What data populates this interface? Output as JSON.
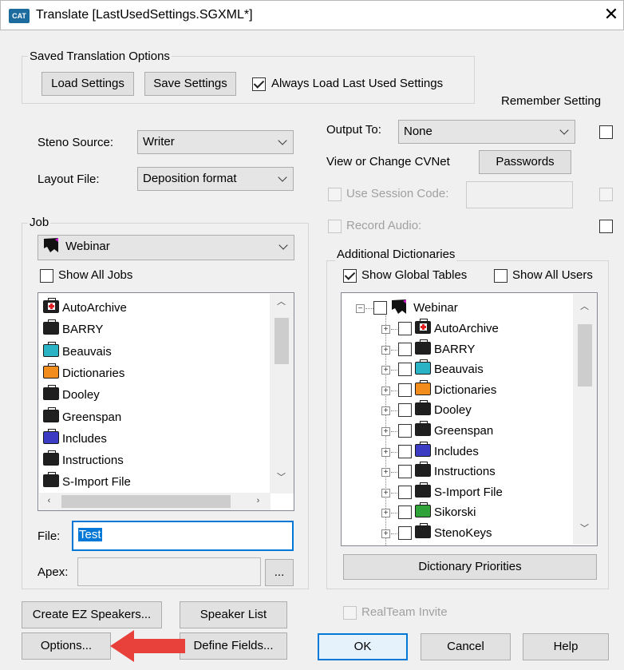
{
  "window": {
    "app_icon_text": "CAT",
    "title": "Translate [LastUsedSettings.SGXML*]",
    "close_glyph": "✕"
  },
  "saved_options": {
    "group_title": "Saved Translation Options",
    "load_label": "Load Settings",
    "save_label": "Save Settings",
    "always_load_label": "Always Load Last Used Settings",
    "always_load_checked": true
  },
  "remember_setting_label": "Remember Setting",
  "steno_source": {
    "label": "Steno Source:",
    "value": "Writer"
  },
  "layout_file": {
    "label": "Layout File:",
    "value": "Deposition format"
  },
  "output": {
    "label": "Output To:",
    "value": "None",
    "remember_checked": false
  },
  "cvnet": {
    "label": "View or Change CVNet",
    "button": "Passwords"
  },
  "session_code": {
    "label": "Use Session Code:",
    "value": ""
  },
  "record_audio": {
    "label": "Record Audio:"
  },
  "job": {
    "group_title": "Job",
    "selected": "Webinar",
    "show_all_label": "Show All Jobs",
    "items": [
      {
        "label": "AutoArchive",
        "color": "#1f1f1f",
        "cross": true
      },
      {
        "label": "BARRY",
        "color": "#1f1f1f",
        "cross": false
      },
      {
        "label": "Beauvais",
        "color": "#2ab3c4",
        "cross": false
      },
      {
        "label": "Dictionaries",
        "color": "#f28c1d",
        "cross": false
      },
      {
        "label": "Dooley",
        "color": "#1f1f1f",
        "cross": false
      },
      {
        "label": "Greenspan",
        "color": "#1f1f1f",
        "cross": false
      },
      {
        "label": "Includes",
        "color": "#3b3bc4",
        "cross": false
      },
      {
        "label": "Instructions",
        "color": "#1f1f1f",
        "cross": false
      },
      {
        "label": "S-Import File",
        "color": "#1f1f1f",
        "cross": false
      }
    ]
  },
  "file": {
    "label": "File:",
    "value": "Test"
  },
  "apex": {
    "label": "Apex:",
    "value": "",
    "browse": "..."
  },
  "dictionaries": {
    "group_title": "Additional Dictionaries",
    "show_global_label": "Show Global Tables",
    "show_global_checked": true,
    "show_all_users_label": "Show All Users",
    "root": "Webinar",
    "items": [
      {
        "label": "AutoArchive",
        "color": "#1f1f1f",
        "cross": true
      },
      {
        "label": "BARRY",
        "color": "#1f1f1f",
        "cross": false
      },
      {
        "label": "Beauvais",
        "color": "#2ab3c4",
        "cross": false
      },
      {
        "label": "Dictionaries",
        "color": "#f28c1d",
        "cross": false
      },
      {
        "label": "Dooley",
        "color": "#1f1f1f",
        "cross": false
      },
      {
        "label": "Greenspan",
        "color": "#1f1f1f",
        "cross": false
      },
      {
        "label": "Includes",
        "color": "#3b3bc4",
        "cross": false
      },
      {
        "label": "Instructions",
        "color": "#1f1f1f",
        "cross": false
      },
      {
        "label": "S-Import File",
        "color": "#1f1f1f",
        "cross": false
      },
      {
        "label": "Sikorski",
        "color": "#2fa33a",
        "cross": false
      },
      {
        "label": "StenoKeys",
        "color": "#1f1f1f",
        "cross": false
      }
    ],
    "priorities_button": "Dictionary Priorities"
  },
  "buttons": {
    "create_ez": "Create EZ Speakers...",
    "speaker_list": "Speaker List",
    "realteam_label": "RealTeam Invite",
    "options": "Options...",
    "define_fields": "Define Fields...",
    "ok": "OK",
    "cancel": "Cancel",
    "help": "Help"
  },
  "accent_colors": {
    "annotation_arrow": "#e8413b",
    "focus_blue": "#0078d7"
  }
}
